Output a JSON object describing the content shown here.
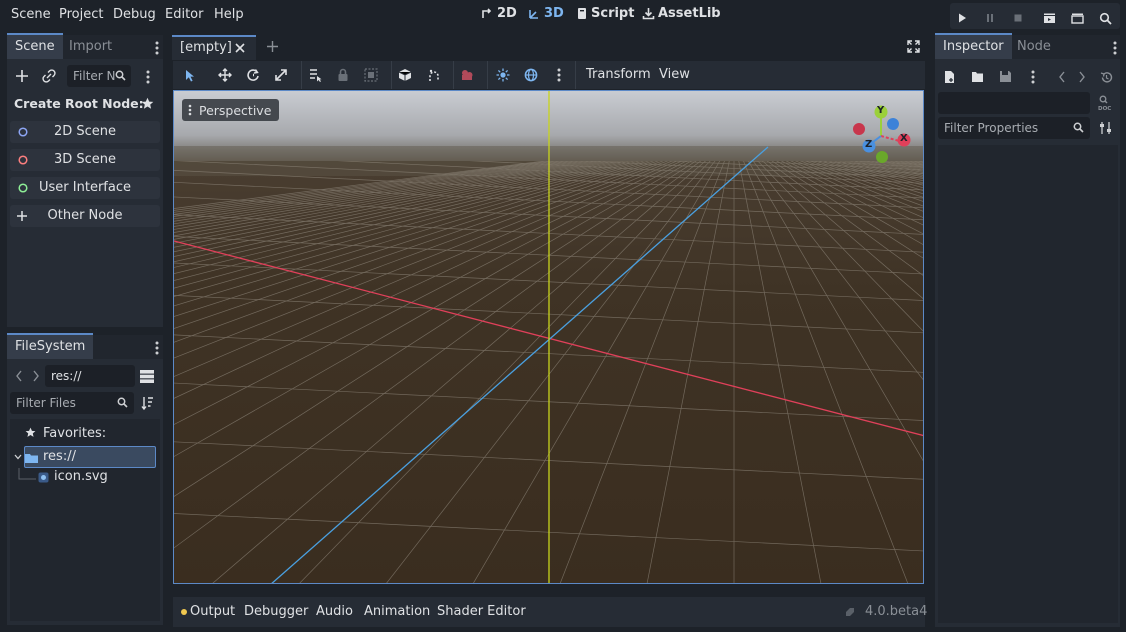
{
  "menubar": {
    "items": [
      "Scene",
      "Project",
      "Debug",
      "Editor",
      "Help"
    ],
    "workspaces": [
      {
        "label": "2D",
        "icon": "2d-icon",
        "active": false
      },
      {
        "label": "3D",
        "icon": "3d-icon",
        "active": true
      },
      {
        "label": "Script",
        "icon": "script-icon",
        "active": false
      },
      {
        "label": "AssetLib",
        "icon": "assetlib-icon",
        "active": false
      }
    ]
  },
  "scene_dock": {
    "tabs": [
      "Scene",
      "Import"
    ],
    "filter_placeholder": "Filter N",
    "create_root_label": "Create Root Node:",
    "root_buttons": [
      {
        "label": "2D Scene",
        "color": "#8da5f3"
      },
      {
        "label": "3D Scene",
        "color": "#fc7f7f"
      },
      {
        "label": "User Interface",
        "color": "#8eef97"
      },
      {
        "label": "Other Node",
        "color": "#dfe1e4"
      }
    ]
  },
  "filesystem": {
    "tab": "FileSystem",
    "path": "res://",
    "filter_placeholder": "Filter Files",
    "favorites_label": "Favorites:",
    "root_label": "res://",
    "file_label": "icon.svg"
  },
  "editor": {
    "scene_tab": "[empty]",
    "toolbar": {
      "transform": "Transform",
      "view": "View"
    },
    "perspective_label": "Perspective",
    "gizmo": {
      "x": "X",
      "y": "Y",
      "z": "Z"
    }
  },
  "bottom_panel": {
    "tabs": [
      "Output",
      "Debugger",
      "Audio",
      "Animation",
      "Shader Editor"
    ],
    "version": "4.0.beta4"
  },
  "inspector": {
    "tabs": [
      "Inspector",
      "Node"
    ],
    "filter_placeholder": "Filter Properties"
  },
  "colors": {
    "accent": "#5c89c7",
    "x_axis": "#e0405a",
    "y_axis": "#c8d41c",
    "z_axis": "#4aa0e0",
    "active_workspace": "#7eb6f0"
  }
}
